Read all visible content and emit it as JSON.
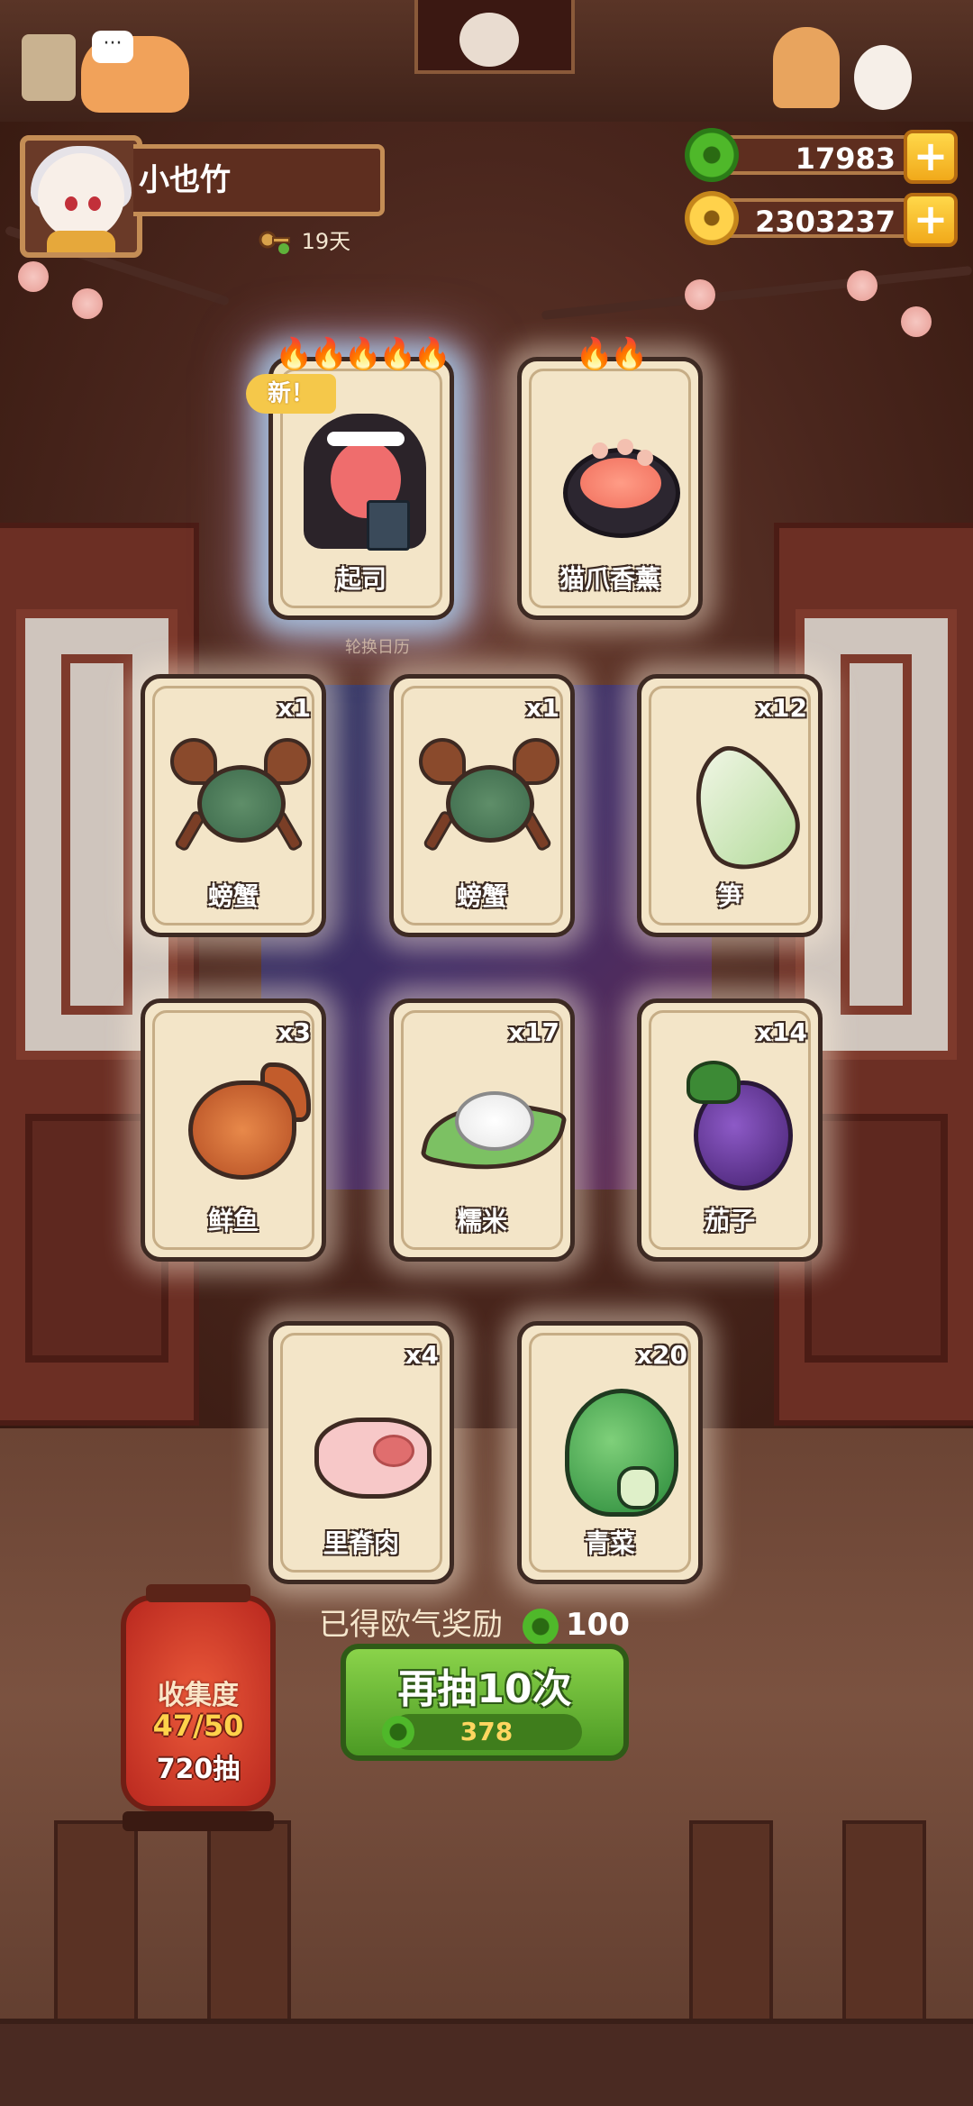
{
  "profile": {
    "name": "小也竹",
    "days": "19天"
  },
  "currency": {
    "jade": "17983",
    "gold": "2303237",
    "add_label": "+"
  },
  "cards_top": [
    {
      "label": "起司",
      "count": "",
      "flames": "🔥🔥🔥🔥🔥",
      "new": "新！",
      "icon": "nun-character-icon"
    },
    {
      "label": "猫爪香薰",
      "count": "",
      "flames": "🔥🔥",
      "icon": "cat-paw-sushi-icon"
    }
  ],
  "subcaption": "轮换日历",
  "cards": [
    {
      "label": "螃蟹",
      "count": "x1",
      "icon": "crab-icon"
    },
    {
      "label": "螃蟹",
      "count": "x1",
      "icon": "crab-icon"
    },
    {
      "label": "笋",
      "count": "x12",
      "icon": "bamboo-shoot-icon"
    },
    {
      "label": "鲜鱼",
      "count": "x3",
      "icon": "fish-icon"
    },
    {
      "label": "糯米",
      "count": "x17",
      "icon": "sticky-rice-icon"
    },
    {
      "label": "茄子",
      "count": "x14",
      "icon": "eggplant-icon"
    },
    {
      "label": "里脊肉",
      "count": "x4",
      "icon": "pork-loin-icon"
    },
    {
      "label": "青菜",
      "count": "x20",
      "icon": "bok-choy-icon"
    }
  ],
  "reward": {
    "text": "已得欧气奖励",
    "amount": "100"
  },
  "draw_button": {
    "label": "再抽10次",
    "cost": "378"
  },
  "collection": {
    "title": "收集度",
    "progress": "47/50",
    "draws": "720抽"
  },
  "colors": {
    "accent_green": "#5aa82c",
    "card_bg": "#f3e5c8",
    "gold": "#ffd24b"
  }
}
